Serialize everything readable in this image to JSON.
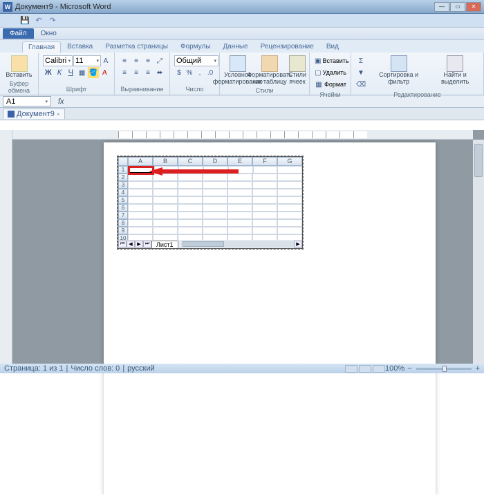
{
  "window": {
    "title": "Документ9 - Microsoft Word"
  },
  "menubar": [
    "Файл",
    "Окно"
  ],
  "ribbon_tabs": [
    "Главная",
    "Вставка",
    "Разметка страницы",
    "Формулы",
    "Данные",
    "Рецензирование",
    "Вид"
  ],
  "active_tab": "Главная",
  "groups": {
    "clipboard": {
      "label": "Буфер обмена",
      "paste": "Вставить"
    },
    "font": {
      "label": "Шрифт",
      "name": "Calibri",
      "size": "11"
    },
    "align": {
      "label": "Выравнивание"
    },
    "number": {
      "label": "Число",
      "format": "Общий"
    },
    "styles": {
      "label": "Стили",
      "cond": "Условное форматирование",
      "table": "Форматировать как таблицу",
      "cell": "Стили ячеек"
    },
    "cells": {
      "label": "Ячейки",
      "insert": "Вставить",
      "delete": "Удалить",
      "format": "Формат"
    },
    "edit": {
      "label": "Редактирование",
      "sort": "Сортировка и фильтр",
      "find": "Найти и выделить"
    }
  },
  "namebox": "A1",
  "fx_label": "fx",
  "doc_tab": "Документ9",
  "sheet": {
    "columns": [
      "A",
      "B",
      "C",
      "D",
      "E",
      "F",
      "G"
    ],
    "rows": [
      "1",
      "2",
      "3",
      "4",
      "5",
      "6",
      "7",
      "8",
      "9",
      "10"
    ],
    "active_cell": "A1",
    "tab": "Лист1"
  },
  "statusbar": {
    "page": "Страница: 1 из 1",
    "words": "Число слов: 0",
    "lang": "русский",
    "zoom": "100%"
  }
}
